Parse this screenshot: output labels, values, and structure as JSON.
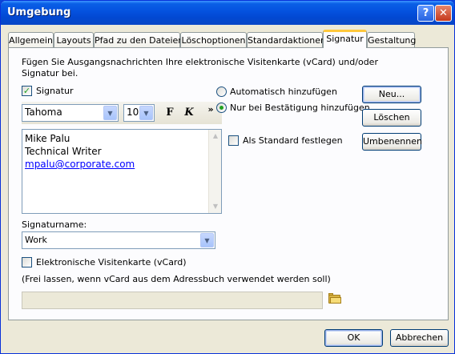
{
  "window": {
    "title": "Umgebung"
  },
  "titlebar": {
    "help_label": "?",
    "close_label": "✕"
  },
  "tabs": [
    {
      "label": "Allgemein"
    },
    {
      "label": "Layouts"
    },
    {
      "label": "Pfad zu den Dateien"
    },
    {
      "label": "Löschoptionen"
    },
    {
      "label": "Standardaktionen"
    },
    {
      "label": "Signatur",
      "active": true
    },
    {
      "label": "Gestaltung"
    }
  ],
  "intro": {
    "line1": "Fügen Sie Ausgangsnachrichten Ihre elektronische Visitenkarte (vCard) und/oder",
    "line2": "Signatur bei."
  },
  "signature": {
    "checkbox_label": "Signatur",
    "checked": true,
    "font_name": "Tahoma",
    "font_size": "10",
    "bold_label": "F",
    "italic_label": "K",
    "more_label": "»",
    "text_lines": [
      "Mike Palu",
      "Technical Writer"
    ],
    "email": "mpalu@corporate.com",
    "name_label": "Signaturname:",
    "name_value": "Work"
  },
  "options": {
    "auto_label": "Automatisch hinzufügen",
    "confirm_label": "Nur bei Bestätigung hinzufügen",
    "selected": "confirm",
    "default_label": "Als Standard festlegen"
  },
  "side_buttons": {
    "new": "Neu...",
    "delete": "Löschen",
    "rename": "Umbenennen"
  },
  "vcard": {
    "checkbox_label": "Elektronische Visitenkarte (vCard)",
    "hint": "(Frei lassen, wenn vCard aus dem Adressbuch verwendet werden soll)",
    "path_value": ""
  },
  "footer": {
    "ok": "OK",
    "cancel": "Abbrechen"
  },
  "colors": {
    "title_bar": "#0553e0",
    "face": "#ece9d8",
    "active_tab_highlight": "#ffc83c",
    "check": "#21a121"
  }
}
